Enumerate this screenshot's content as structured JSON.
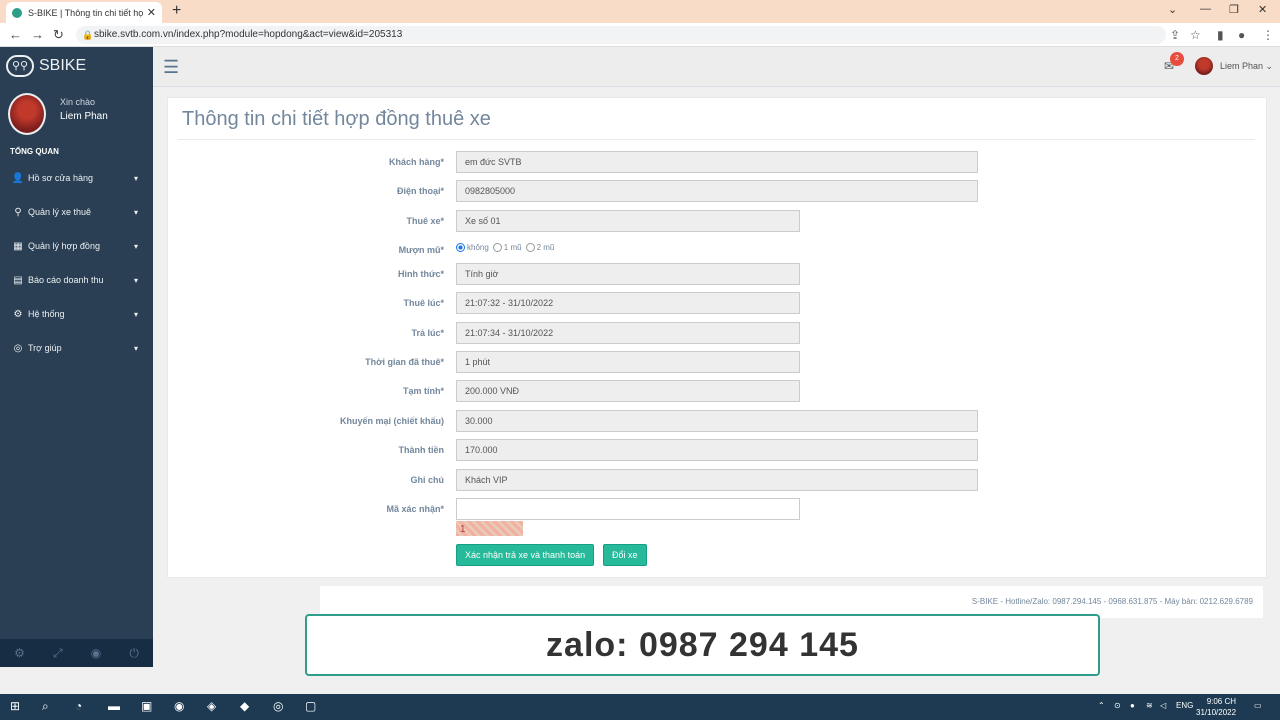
{
  "browser": {
    "tab_title": "S-BIKE | Thông tin chi tiết hợp đồ",
    "url": "sbike.svtb.com.vn/index.php?module=hopdong&act=view&id=205313"
  },
  "sidebar": {
    "brand": "SBIKE",
    "greeting": "Xin chào",
    "user_name": "Liem Phan",
    "section": "TỔNG QUAN",
    "items": [
      {
        "label": "Hồ sơ cửa hàng",
        "icon": "user-icon"
      },
      {
        "label": "Quản lý xe thuê",
        "icon": "bicycle-icon"
      },
      {
        "label": "Quản lý hợp đồng",
        "icon": "table-icon"
      },
      {
        "label": "Báo cáo doanh thu",
        "icon": "report-icon"
      },
      {
        "label": "Hệ thống",
        "icon": "gear-icon"
      },
      {
        "label": "Trợ giúp",
        "icon": "lifebuoy-icon"
      }
    ]
  },
  "topnav": {
    "notification_count": "2",
    "user_name": "Liem Phan"
  },
  "page": {
    "title": "Thông tin chi tiết hợp đồng thuê xe",
    "fields": {
      "khach_hang": {
        "label": "Khách hàng*",
        "value": "em đức SVTB"
      },
      "dien_thoai": {
        "label": "Điện thoại*",
        "value": "0982805000"
      },
      "thue_xe": {
        "label": "Thuê xe*",
        "value": "Xe số 01"
      },
      "muon_mu": {
        "label": "Mượn mũ*",
        "options": [
          "không",
          "1 mũ",
          "2 mũ"
        ],
        "selected": "không"
      },
      "hinh_thuc": {
        "label": "Hình thức*",
        "value": "Tính giờ"
      },
      "thue_luc": {
        "label": "Thuê lúc*",
        "value": "21:07:32 - 31/10/2022"
      },
      "tra_luc": {
        "label": "Trả lúc*",
        "value": "21:07:34 - 31/10/2022"
      },
      "thoi_gian": {
        "label": "Thời gian đã thuê*",
        "value": "1 phút"
      },
      "tam_tinh": {
        "label": "Tạm tính*",
        "value": "200.000 VNĐ"
      },
      "khuyen_mai": {
        "label": "Khuyến mại (chiết khấu)",
        "value": "30.000"
      },
      "thanh_tien": {
        "label": "Thành tiền",
        "value": "170.000"
      },
      "ghi_chu": {
        "label": "Ghi chú",
        "value": "Khách VIP"
      },
      "ma_xac_nhan": {
        "label": "Mã xác nhận*",
        "value": ""
      }
    },
    "captcha_text": "1",
    "buttons": {
      "confirm": "Xác nhận trả xe và thanh toán",
      "change": "Đổi xe"
    }
  },
  "footer": "S-BIKE - Hotline/Zalo: 0987.294.145 - 0968.631.875 - Máy bàn: 0212.629.6789",
  "banner": "zalo: 0987 294 145",
  "taskbar": {
    "lang": "ENG",
    "time": "9:06 CH",
    "date": "31/10/2022"
  }
}
